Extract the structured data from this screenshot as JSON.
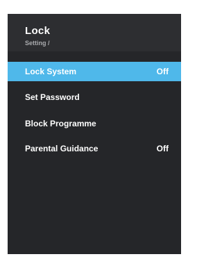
{
  "header": {
    "title": "Lock",
    "breadcrumb": "Setting /"
  },
  "menu": {
    "items": [
      {
        "label": "Lock System",
        "value": "Off",
        "selected": true
      },
      {
        "label": "Set Password",
        "value": ""
      },
      {
        "label": "Block Programme",
        "value": ""
      },
      {
        "label": "Parental Guidance",
        "value": "Off"
      }
    ]
  },
  "colors": {
    "panel_background": "#252629",
    "header_background": "#2d2e31",
    "selection_highlight": "#4fb8ea",
    "text": "#ffffff",
    "breadcrumb_text": "#a9aaad"
  }
}
